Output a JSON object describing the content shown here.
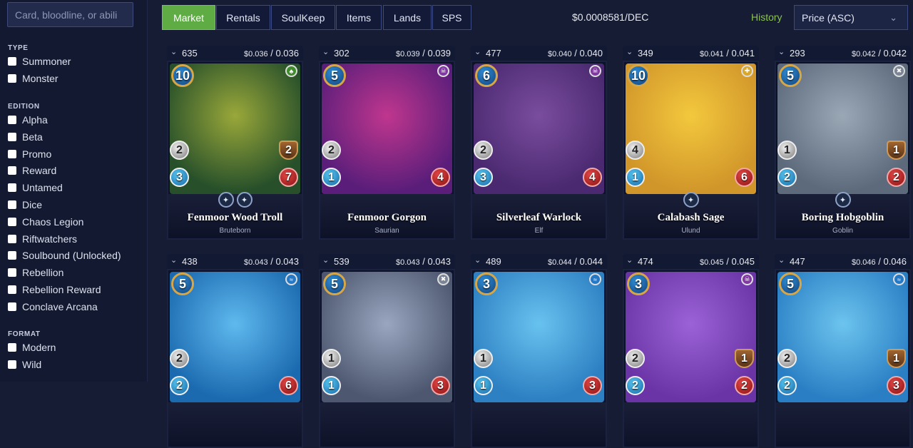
{
  "search": {
    "placeholder": "Card, bloodline, or abili"
  },
  "filters": {
    "type": {
      "title": "TYPE",
      "options": [
        "Summoner",
        "Monster"
      ]
    },
    "edition": {
      "title": "EDITION",
      "options": [
        "Alpha",
        "Beta",
        "Promo",
        "Reward",
        "Untamed",
        "Dice",
        "Chaos Legion",
        "Riftwatchers",
        "Soulbound (Unlocked)",
        "Rebellion",
        "Rebellion Reward",
        "Conclave Arcana"
      ]
    },
    "format": {
      "title": "FORMAT",
      "options": [
        "Modern",
        "Wild"
      ]
    }
  },
  "tabs": [
    "Market",
    "Rentals",
    "SoulKeep",
    "Items",
    "Lands",
    "SPS"
  ],
  "active_tab": "Market",
  "rate": "$0.0008581/DEC",
  "history_label": "History",
  "sort": {
    "selected": "Price (ASC)"
  },
  "colors": {
    "accent_green": "#5fac44",
    "history_green": "#8cc152",
    "bg": "#161c33"
  },
  "cards": [
    {
      "qty": "635",
      "price_low": "$0.036",
      "price_high": "/ 0.036",
      "name": "Fenmoor Wood Troll",
      "type": "Bruteborn",
      "mana": "10",
      "attack": "2",
      "speed": "3",
      "armor": "2",
      "health": "7",
      "element": "earth-icon",
      "abilities": [
        "ability-icon",
        "ability-icon"
      ],
      "art": [
        "#264f2a",
        "#9aa83a"
      ]
    },
    {
      "qty": "302",
      "price_low": "$0.039",
      "price_high": "/ 0.039",
      "name": "Fenmoor Gorgon",
      "type": "Saurian",
      "mana": "5",
      "attack": "2",
      "speed": "1",
      "armor": "",
      "health": "4",
      "element": "death-icon",
      "abilities": [],
      "art": [
        "#5a1e7a",
        "#c0368e"
      ]
    },
    {
      "qty": "477",
      "price_low": "$0.040",
      "price_high": "/ 0.040",
      "name": "Silverleaf Warlock",
      "type": "Elf",
      "mana": "6",
      "attack": "2",
      "speed": "3",
      "armor": "",
      "health": "4",
      "element": "death-icon",
      "abilities": [],
      "art": [
        "#4a2970",
        "#7a4d9e"
      ]
    },
    {
      "qty": "349",
      "price_low": "$0.041",
      "price_high": "/ 0.041",
      "name": "Calabash Sage",
      "type": "Ulund",
      "mana": "10",
      "attack": "4",
      "speed": "1",
      "armor": "",
      "health": "6",
      "element": "life-icon",
      "abilities": [
        "ability-icon"
      ],
      "art": [
        "#d1962a",
        "#f3c83d"
      ]
    },
    {
      "qty": "293",
      "price_low": "$0.042",
      "price_high": "/ 0.042",
      "name": "Boring Hobgoblin",
      "type": "Goblin",
      "mana": "5",
      "attack": "1",
      "speed": "2",
      "armor": "1",
      "health": "2",
      "element": "neutral-icon",
      "abilities": [
        "ability-icon"
      ],
      "art": [
        "#5c6a7c",
        "#9aa8b6"
      ]
    },
    {
      "qty": "438",
      "price_low": "$0.043",
      "price_high": "/ 0.043",
      "name": "",
      "type": "",
      "mana": "5",
      "attack": "2",
      "speed": "2",
      "armor": "",
      "health": "6",
      "element": "water-icon",
      "abilities": [],
      "art": [
        "#1b6ab0",
        "#5fb9ee"
      ]
    },
    {
      "qty": "539",
      "price_low": "$0.043",
      "price_high": "/ 0.043",
      "name": "",
      "type": "",
      "mana": "5",
      "attack": "1",
      "speed": "1",
      "armor": "",
      "health": "3",
      "element": "neutral-icon",
      "abilities": [],
      "art": [
        "#4d5870",
        "#9aa5bf"
      ]
    },
    {
      "qty": "489",
      "price_low": "$0.044",
      "price_high": "/ 0.044",
      "name": "",
      "type": "",
      "mana": "3",
      "attack": "1",
      "speed": "1",
      "armor": "",
      "health": "3",
      "element": "water-icon",
      "abilities": [],
      "art": [
        "#2d80c2",
        "#68c2ef"
      ]
    },
    {
      "qty": "474",
      "price_low": "$0.045",
      "price_high": "/ 0.045",
      "name": "",
      "type": "",
      "mana": "3",
      "attack": "2",
      "speed": "2",
      "armor": "1",
      "health": "2",
      "element": "death-icon",
      "abilities": [],
      "art": [
        "#6a34a6",
        "#9a62d6"
      ]
    },
    {
      "qty": "447",
      "price_low": "$0.046",
      "price_high": "/ 0.046",
      "name": "",
      "type": "",
      "mana": "5",
      "attack": "2",
      "speed": "2",
      "armor": "1",
      "health": "3",
      "element": "water-icon",
      "abilities": [],
      "art": [
        "#2a7fc4",
        "#6cc4ee"
      ]
    }
  ]
}
